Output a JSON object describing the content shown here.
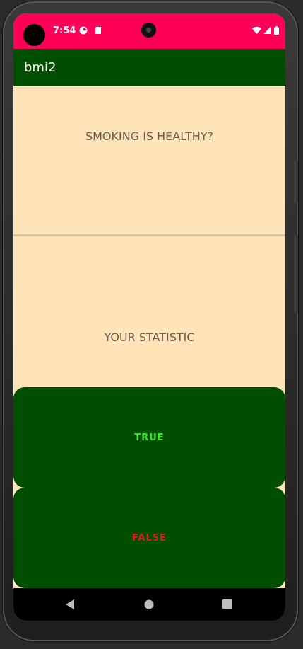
{
  "status_bar": {
    "time": "7:54",
    "background": "#ff0058"
  },
  "app_bar": {
    "title": "bmi2",
    "background": "#004f00"
  },
  "question": {
    "text": "SMOKING IS HEALTHY?"
  },
  "statistic": {
    "text": "YOUR STATISTIC"
  },
  "buttons": {
    "true_label": "TRUE",
    "false_label": "FALSE",
    "true_color": "#3ee62b",
    "false_color": "#e01b14",
    "background": "#004f00"
  },
  "nav": {
    "back_icon": "back-triangle-icon",
    "home_icon": "home-circle-icon",
    "recents_icon": "recents-square-icon"
  },
  "colors": {
    "content_background": "#ffe4b8"
  }
}
